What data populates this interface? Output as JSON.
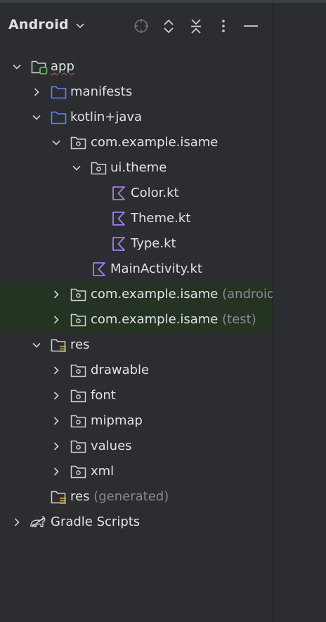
{
  "header": {
    "view_label": "Android",
    "icons": [
      "crosshair-icon",
      "expand-icon",
      "collapse-icon",
      "more-icon",
      "minimize-icon"
    ]
  },
  "tree": {
    "app": "app",
    "manifests": "manifests",
    "kotlin_java": "kotlin+java",
    "pkg_main": "com.example.isame",
    "ui_theme": "ui.theme",
    "color_kt": "Color.kt",
    "theme_kt": "Theme.kt",
    "type_kt": "Type.kt",
    "main_activity": "MainActivity.kt",
    "pkg_android_test": "com.example.isame",
    "pkg_android_test_hint": "(androidTest)",
    "pkg_test": "com.example.isame",
    "pkg_test_hint": "(test)",
    "res": "res",
    "drawable": "drawable",
    "font": "font",
    "mipmap": "mipmap",
    "values": "values",
    "xml": "xml",
    "res_generated": "res",
    "res_generated_hint": "(generated)",
    "gradle_scripts": "Gradle Scripts"
  },
  "colors": {
    "background": "#2b2d30",
    "selected_row": "#253322",
    "folder_blue": "#548af7",
    "kotlin_purple": "#a57cf6",
    "module_green": "#5fb865",
    "hint_text": "#868a91"
  }
}
